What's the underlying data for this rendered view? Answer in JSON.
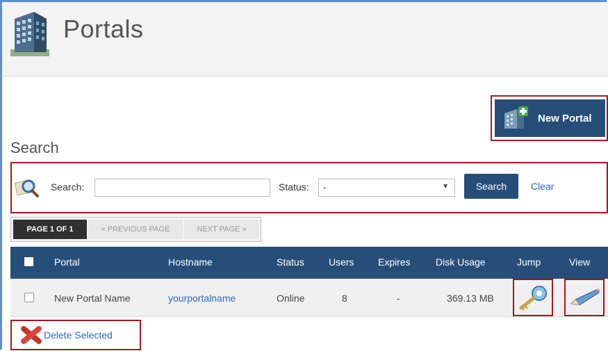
{
  "header": {
    "title": "Portals",
    "icon": "office-building-icon"
  },
  "actions": {
    "new_portal_label": "New Portal"
  },
  "search": {
    "section_title": "Search",
    "search_label": "Search:",
    "search_value": "",
    "status_label": "Status:",
    "status_value": "-",
    "search_button": "Search",
    "clear_link": "Clear"
  },
  "pagination": {
    "current": "PAGE 1 OF 1",
    "prev": "« PREVIOUS PAGE",
    "next": "NEXT PAGE »"
  },
  "table": {
    "columns": [
      "Portal",
      "Hostname",
      "Status",
      "Users",
      "Expires",
      "Disk Usage",
      "Jump",
      "View"
    ],
    "rows": [
      {
        "portal": "New Portal Name",
        "hostname": "yourportalname",
        "status": "Online",
        "users": "8",
        "expires": "-",
        "disk_usage": "369.13 MB",
        "jump_icon": "key-icon",
        "view_icon": "pencil-icon"
      }
    ]
  },
  "footer": {
    "delete_label": "Delete Selected"
  },
  "colors": {
    "primary": "#274e79",
    "highlight_border": "#a5161f",
    "link": "#2a6ab4"
  }
}
